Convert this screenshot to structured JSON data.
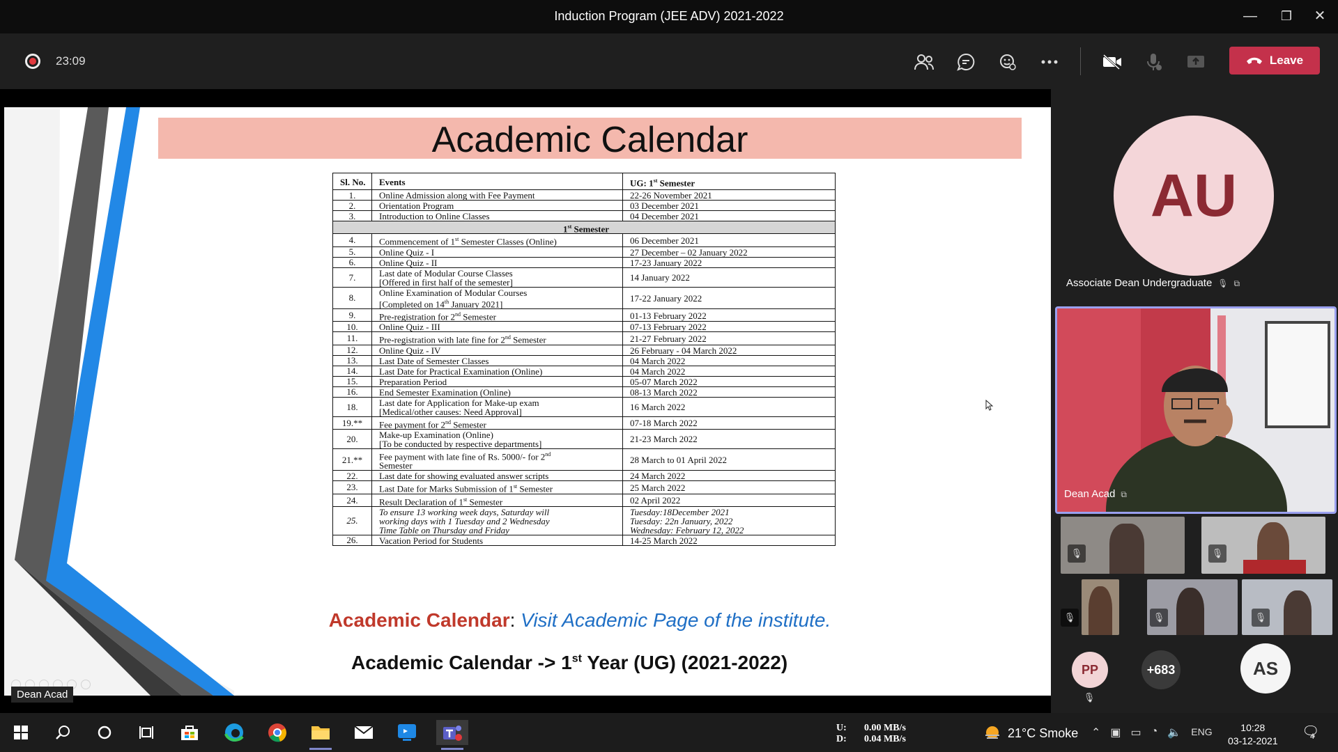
{
  "window": {
    "title": "Induction Program (JEE ADV) 2021-2022",
    "minimize": "—",
    "restore": "❐",
    "close": "✕"
  },
  "toolbar": {
    "timer": "23:09",
    "leave_label": "Leave"
  },
  "slide": {
    "title": "Academic Calendar",
    "headers": [
      "Sl. No.",
      "Events",
      "UG: 1st Semester"
    ],
    "section": "1st Semester",
    "rows_a": [
      [
        "1.",
        "Online Admission along with Fee Payment",
        "22-26 November 2021"
      ],
      [
        "2.",
        "Orientation Program",
        "03 December 2021"
      ],
      [
        "3.",
        "Introduction to Online Classes",
        "04 December 2021"
      ]
    ],
    "rows_b": [
      [
        "4.",
        "Commencement of 1st Semester Classes (Online)",
        "06 December 2021"
      ],
      [
        "5.",
        "Online Quiz - I",
        "27 December – 02 January 2022"
      ],
      [
        "6.",
        "Online Quiz - II",
        "17-23 January 2022"
      ],
      [
        "7.",
        "Last date of Modular Course Classes\n[Offered in first half of the semester]",
        "14 January 2022"
      ],
      [
        "8.",
        "Online Examination of Modular Courses\n[Completed on 14th January 2021]",
        "17-22 January 2022"
      ],
      [
        "9.",
        "Pre-registration for 2nd Semester",
        "01-13 February 2022"
      ],
      [
        "10.",
        "Online Quiz - III",
        "07-13 February 2022"
      ],
      [
        "11.",
        "Pre-registration with late fine for 2nd Semester",
        "21-27 February 2022"
      ],
      [
        "12.",
        "Online Quiz - IV",
        "26 February - 04 March 2022"
      ],
      [
        "13.",
        "Last Date of Semester Classes",
        "04 March 2022"
      ],
      [
        "14.",
        "Last Date for Practical Examination (Online)",
        "04 March 2022"
      ],
      [
        "15.",
        "Preparation Period",
        "05-07 March 2022"
      ],
      [
        "16.",
        "End Semester Examination (Online)",
        "08-13 March 2022"
      ],
      [
        "18.",
        "Last date for Application for Make-up exam\n[Medical/other causes: Need Approval]",
        "16 March 2022"
      ],
      [
        "19.**",
        "Fee payment for 2nd Semester",
        "07-18 March 2022"
      ],
      [
        "20.",
        "Make-up Examination (Online)\n[To be conducted by respective departments]",
        "21-23 March 2022"
      ],
      [
        "21.**",
        "Fee payment with late fine of Rs. 5000/- for 2nd\nSemester",
        "28 March to 01 April 2022"
      ],
      [
        "22.",
        "Last date for showing evaluated answer scripts",
        "24 March 2022"
      ],
      [
        "23.",
        "Last Date for Marks Submission of 1st Semester",
        "25 March 2022"
      ],
      [
        "24.",
        "Result Declaration of 1st Semester",
        "02 April 2022"
      ],
      [
        "25.",
        "To ensure 13 working week days, Saturday will\nworking days with 1 Tuesday and 2 Wednesday\nTime Table on Thursday and Friday",
        "Tuesday:18December 2021\nTuesday: 22n January, 2022\nWednesday: February 12, 2022"
      ],
      [
        "26.",
        "Vacation Period for Students",
        "14-25 March 2022"
      ]
    ],
    "link_prefix": "Academic Calendar",
    "link_sep": ": ",
    "link_text": "Visit Academic Page of the institute.",
    "year_text_a": "Academic Calendar -> 1",
    "year_sup": "st",
    "year_text_b": " Year (UG) (2021-2022)",
    "presenter": "Dean Acad"
  },
  "participants": {
    "au_initials": "AU",
    "au_name": "Associate Dean Undergraduate",
    "speaker_name": "Dean Acad",
    "pp": "PP",
    "more": "+683",
    "as": "AS"
  },
  "taskbar": {
    "net_up_label": "U:",
    "net_up": "0.00 MB/s",
    "net_down_label": "D:",
    "net_down": "0.04 MB/s",
    "weather": "21°C  Smoke",
    "lang": "ENG",
    "time": "10:28",
    "date": "03-12-2021",
    "notif_count": "4"
  },
  "colors": {
    "leave": "#c4314b",
    "title_band": "#f4b8ad",
    "speaker_border": "#9aa0ef"
  }
}
